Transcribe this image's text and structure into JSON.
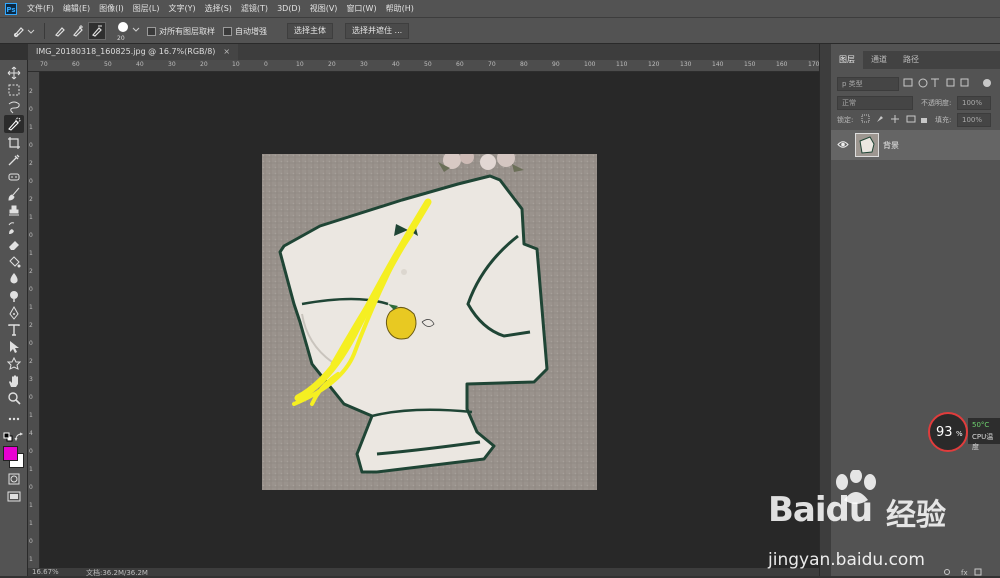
{
  "app": {
    "logo": "Ps"
  },
  "menu": [
    "文件(F)",
    "编辑(E)",
    "图像(I)",
    "图层(L)",
    "文字(Y)",
    "选择(S)",
    "滤镜(T)",
    "3D(D)",
    "视图(V)",
    "窗口(W)",
    "帮助(H)"
  ],
  "options": {
    "brush_size": "20",
    "sample_all_layers": "对所有图层取样",
    "auto_enhance": "自动增强",
    "select_subject": "选择主体",
    "select_and_mask": "选择并遮住 ..."
  },
  "document": {
    "tab_title": "IMG_20180318_160825.jpg @ 16.7%(RGB/8)",
    "close": "×",
    "zoom": "16.67%",
    "doc_size": "文档:36.2M/36.2M"
  },
  "ruler_h": [
    "70",
    "60",
    "50",
    "40",
    "30",
    "20",
    "10",
    "0",
    "10",
    "20",
    "30",
    "40",
    "50",
    "60",
    "70",
    "80",
    "90",
    "100",
    "110",
    "120",
    "130",
    "140",
    "150",
    "160",
    "170"
  ],
  "ruler_v": [
    "2",
    "0",
    "1",
    "0",
    "2",
    "0",
    "2",
    "1",
    "0",
    "1",
    "2",
    "0",
    "1",
    "2",
    "0",
    "2",
    "3",
    "0",
    "1",
    "4",
    "0",
    "1",
    "0",
    "1",
    "1",
    "0",
    "1"
  ],
  "panels": {
    "tabs": [
      "图层",
      "通道",
      "路径"
    ],
    "kind_filter": "p 类型",
    "blend_mode": "正常",
    "opacity_label": "不透明度:",
    "opacity_value": "100%",
    "lock_label": "锁定:",
    "fill_label": "填充:",
    "fill_value": "100%",
    "layers": [
      {
        "name": "背景"
      }
    ]
  },
  "colors": {
    "foreground": "#e800d2",
    "background": "#ffffff"
  },
  "cpu_widget": {
    "percent": "93",
    "percent_sign": "%",
    "temp": "50°C",
    "label": "CPU温度"
  },
  "watermark": {
    "brand": "Baidu",
    "product": "经验",
    "url": "jingyan.baidu.com"
  }
}
